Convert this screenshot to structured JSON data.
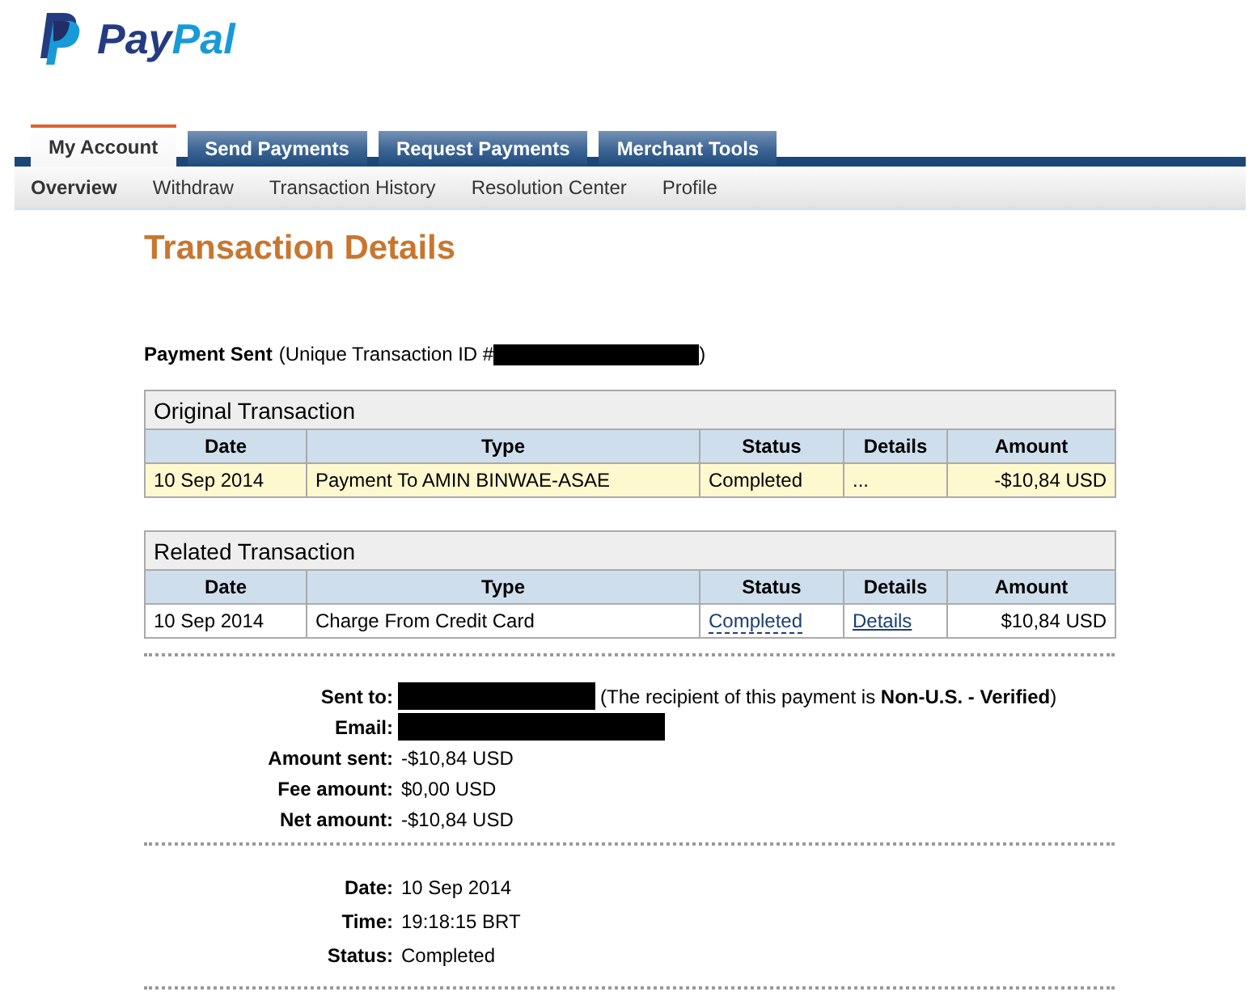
{
  "logo": {
    "parts": [
      "Pay",
      "Pal"
    ]
  },
  "tabs": [
    {
      "label": "My Account",
      "selected": true
    },
    {
      "label": "Send Payments",
      "selected": false
    },
    {
      "label": "Request Payments",
      "selected": false
    },
    {
      "label": "Merchant Tools",
      "selected": false
    }
  ],
  "subnav": [
    {
      "label": "Overview",
      "selected": true
    },
    {
      "label": "Withdraw",
      "selected": false
    },
    {
      "label": "Transaction History",
      "selected": false
    },
    {
      "label": "Resolution Center",
      "selected": false
    },
    {
      "label": "Profile",
      "selected": false
    }
  ],
  "page_title": "Transaction Details",
  "summary": {
    "label": "Payment Sent",
    "note": "(Unique Transaction ID #",
    "id_redacted": true,
    "close": ")"
  },
  "tables": [
    {
      "caption": "Original Transaction",
      "columns": [
        "Date",
        "Type",
        "Status",
        "Details",
        "Amount"
      ],
      "rows": [
        {
          "highlighted": true,
          "cells": [
            {
              "text": "10 Sep 2014",
              "kind": "plain"
            },
            {
              "text": "Payment To AMIN BINWAE-ASAE",
              "kind": "plain"
            },
            {
              "text": "Completed",
              "kind": "plain"
            },
            {
              "text": "...",
              "kind": "plain"
            },
            {
              "text": "-$10,84 USD",
              "kind": "plain"
            }
          ]
        }
      ]
    },
    {
      "caption": "Related Transaction",
      "columns": [
        "Date",
        "Type",
        "Status",
        "Details",
        "Amount"
      ],
      "rows": [
        {
          "highlighted": false,
          "cells": [
            {
              "text": "10 Sep 2014",
              "kind": "plain"
            },
            {
              "text": "Charge From Credit Card",
              "kind": "plain"
            },
            {
              "text": "Completed",
              "kind": "dashed-link"
            },
            {
              "text": "Details",
              "kind": "link"
            },
            {
              "text": "$10,84 USD",
              "kind": "plain"
            }
          ]
        }
      ]
    }
  ],
  "details": [
    {
      "rows": [
        {
          "label": "Sent to:",
          "redacted": true,
          "note": "(The recipient of this payment is **Non-U.S. - Verified**)"
        },
        {
          "label": "Email:",
          "redacted": true
        },
        {
          "label": "Amount sent:",
          "value": "-$10,84 USD"
        },
        {
          "label": "Fee amount:",
          "value": "$0,00 USD"
        },
        {
          "label": "Net amount:",
          "value": "-$10,84 USD"
        }
      ]
    },
    {
      "rows": [
        {
          "label": "Date:",
          "value": "10 Sep 2014"
        },
        {
          "label": "Time:",
          "value": "19:18:15 BRT"
        },
        {
          "label": "Status:",
          "value": "Completed"
        }
      ]
    }
  ]
}
